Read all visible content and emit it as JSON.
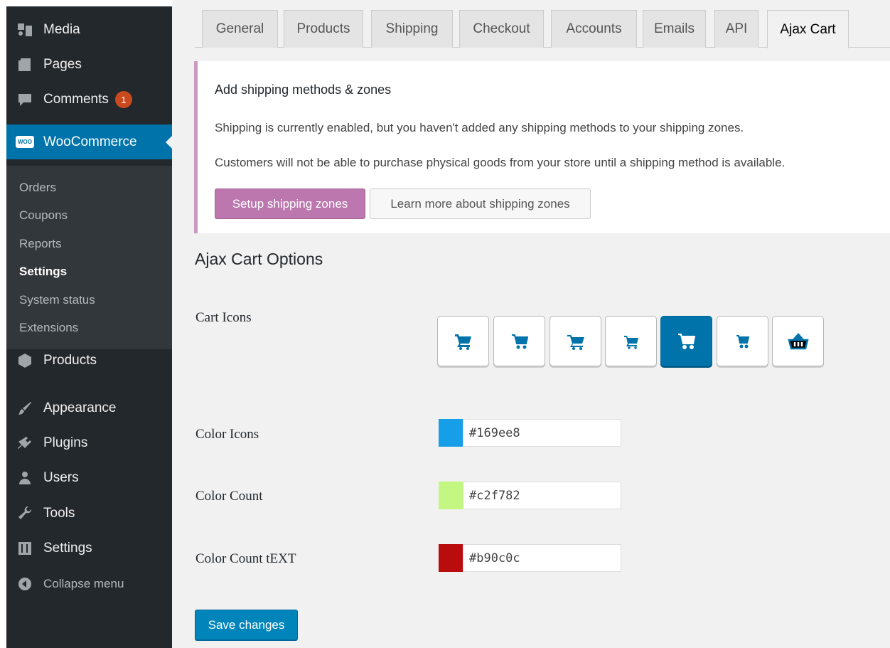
{
  "sidebar": {
    "menu": [
      {
        "label": "Media",
        "icon": "media-icon"
      },
      {
        "label": "Pages",
        "icon": "pages-icon"
      },
      {
        "label": "Comments",
        "icon": "comments-icon",
        "badge": "1"
      },
      {
        "label": "WooCommerce",
        "icon": "woocommerce-icon",
        "icon_text": "WOO",
        "active": true
      },
      {
        "label": "Products",
        "icon": "products-icon"
      },
      {
        "label": "Appearance",
        "icon": "appearance-icon"
      },
      {
        "label": "Plugins",
        "icon": "plugins-icon"
      },
      {
        "label": "Users",
        "icon": "users-icon"
      },
      {
        "label": "Tools",
        "icon": "tools-icon"
      },
      {
        "label": "Settings",
        "icon": "settings-icon"
      },
      {
        "label": "Collapse menu",
        "icon": "collapse-icon"
      }
    ],
    "submenu": [
      {
        "label": "Orders"
      },
      {
        "label": "Coupons"
      },
      {
        "label": "Reports"
      },
      {
        "label": "Settings",
        "current": true
      },
      {
        "label": "System status"
      },
      {
        "label": "Extensions"
      }
    ]
  },
  "tabs": [
    {
      "label": "General"
    },
    {
      "label": "Products"
    },
    {
      "label": "Shipping"
    },
    {
      "label": "Checkout"
    },
    {
      "label": "Accounts"
    },
    {
      "label": "Emails"
    },
    {
      "label": "API"
    },
    {
      "label": "Ajax Cart",
      "active": true
    }
  ],
  "notice": {
    "title": "Add shipping methods & zones",
    "line1": "Shipping is currently enabled, but you haven't added any shipping methods to your shipping zones.",
    "line2": "Customers will not be able to purchase physical goods from your store until a shipping method is available.",
    "primary_button": "Setup shipping zones",
    "secondary_button": "Learn more about shipping zones"
  },
  "options": {
    "title": "Ajax Cart Options",
    "cart_icons_label": "Cart Icons",
    "cart_icons": [
      {
        "icon": "cart-icon-1"
      },
      {
        "icon": "cart-icon-2"
      },
      {
        "icon": "cart-icon-3"
      },
      {
        "icon": "cart-icon-4"
      },
      {
        "icon": "cart-icon-5",
        "selected": true
      },
      {
        "icon": "cart-icon-6"
      },
      {
        "icon": "basket-icon"
      }
    ],
    "color_icons": {
      "label": "Color Icons",
      "value": "#169ee8"
    },
    "color_count": {
      "label": "Color Count",
      "value": "#c2f782"
    },
    "color_count_text": {
      "label": "Color Count tEXT",
      "value": "#b90c0c"
    },
    "save_button": "Save changes"
  },
  "colors": {
    "sidebar_bg": "#23282d",
    "active_menu": "#0073aa",
    "notice_accent": "#cc99c2",
    "woo_button": "#bb77ae",
    "save_button": "#0085ba"
  }
}
